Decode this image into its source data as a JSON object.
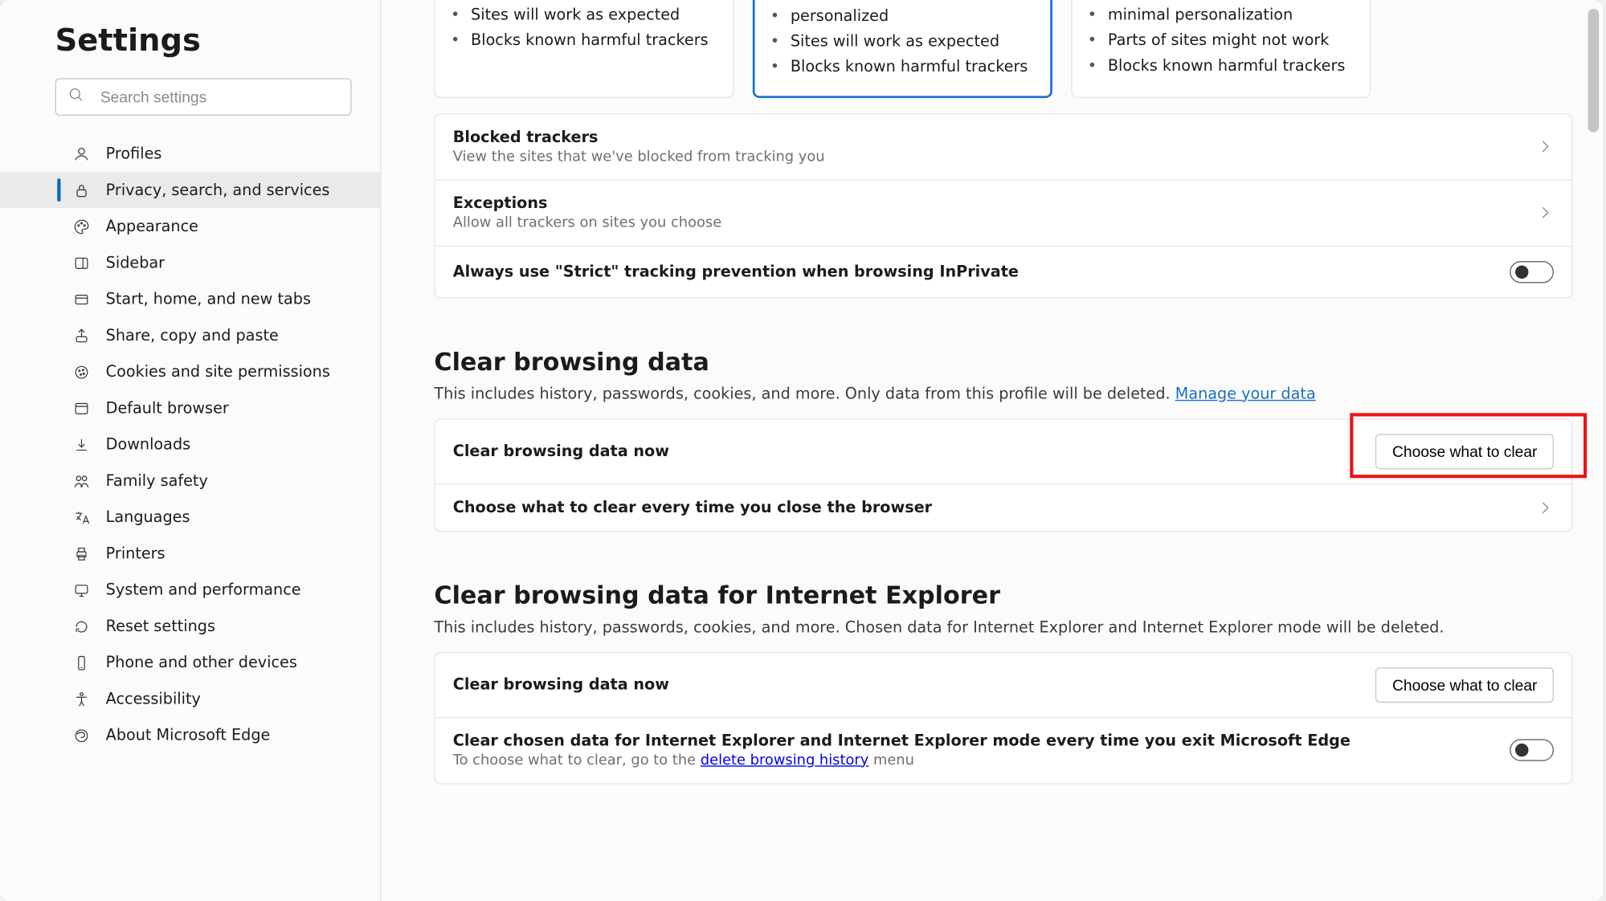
{
  "page_title": "Settings",
  "search": {
    "placeholder": "Search settings"
  },
  "sidebar": {
    "items": [
      {
        "label": "Profiles"
      },
      {
        "label": "Privacy, search, and services"
      },
      {
        "label": "Appearance"
      },
      {
        "label": "Sidebar"
      },
      {
        "label": "Start, home, and new tabs"
      },
      {
        "label": "Share, copy and paste"
      },
      {
        "label": "Cookies and site permissions"
      },
      {
        "label": "Default browser"
      },
      {
        "label": "Downloads"
      },
      {
        "label": "Family safety"
      },
      {
        "label": "Languages"
      },
      {
        "label": "Printers"
      },
      {
        "label": "System and performance"
      },
      {
        "label": "Reset settings"
      },
      {
        "label": "Phone and other devices"
      },
      {
        "label": "Accessibility"
      },
      {
        "label": "About Microsoft Edge"
      }
    ]
  },
  "tracking": {
    "cards": [
      {
        "bullets": [
          "Sites will work as expected",
          "Blocks known harmful trackers"
        ]
      },
      {
        "bullets": [
          "personalized",
          "Sites will work as expected",
          "Blocks known harmful trackers"
        ]
      },
      {
        "bullets": [
          "minimal personalization",
          "Parts of sites might not work",
          "Blocks known harmful trackers"
        ]
      }
    ],
    "blocked_title": "Blocked trackers",
    "blocked_sub": "View the sites that we've blocked from tracking you",
    "exceptions_title": "Exceptions",
    "exceptions_sub": "Allow all trackers on sites you choose",
    "strict_title": "Always use \"Strict\" tracking prevention when browsing InPrivate"
  },
  "clear": {
    "heading": "Clear browsing data",
    "desc_pre": "This includes history, passwords, cookies, and more. Only data from this profile will be deleted. ",
    "desc_link": "Manage your data",
    "now_title": "Clear browsing data now",
    "choose_btn": "Choose what to clear",
    "everytime_title": "Choose what to clear every time you close the browser"
  },
  "ie": {
    "heading": "Clear browsing data for Internet Explorer",
    "desc": "This includes history, passwords, cookies, and more. Chosen data for Internet Explorer and Internet Explorer mode will be deleted.",
    "now_title": "Clear browsing data now",
    "choose_btn": "Choose what to clear",
    "chosen_title": "Clear chosen data for Internet Explorer and Internet Explorer mode every time you exit Microsoft Edge",
    "chosen_sub_pre": "To choose what to clear, go to the ",
    "chosen_sub_link": "delete browsing history",
    "chosen_sub_post": " menu"
  }
}
